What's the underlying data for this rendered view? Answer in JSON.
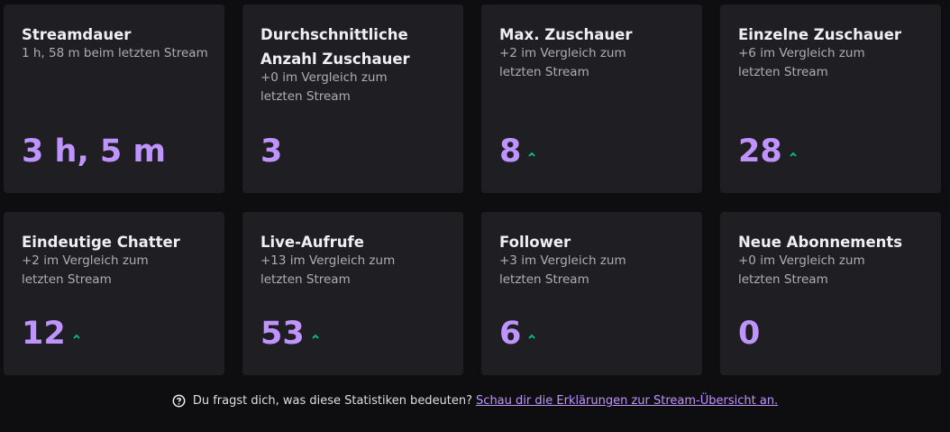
{
  "colors": {
    "accent": "#bf94ff",
    "up": "#00c28f",
    "card_bg": "#1f1f23",
    "page_bg": "#0e0e10"
  },
  "cards": [
    {
      "title": "Streamdauer",
      "sub": "1 h, 58 m beim letzten Stream",
      "value": "3 h, 5 m",
      "trend": ""
    },
    {
      "title": "Durchschnittliche Anzahl Zuschauer",
      "sub": "+0 im Vergleich zum letzten Stream",
      "value": "3",
      "trend": ""
    },
    {
      "title": "Max. Zuschauer",
      "sub": "+2 im Vergleich zum letzten Stream",
      "value": "8",
      "trend": "up"
    },
    {
      "title": "Einzelne Zuschauer",
      "sub": "+6 im Vergleich zum letzten Stream",
      "value": "28",
      "trend": "up"
    },
    {
      "title": "Eindeutige Chatter",
      "sub": "+2 im Vergleich zum letzten Stream",
      "value": "12",
      "trend": "up"
    },
    {
      "title": "Live-Aufrufe",
      "sub": "+13 im Vergleich zum letzten Stream",
      "value": "53",
      "trend": "up"
    },
    {
      "title": "Follower",
      "sub": "+3 im Vergleich zum letzten Stream",
      "value": "6",
      "trend": "up"
    },
    {
      "title": "Neue Abonnements",
      "sub": "+0 im Vergleich zum letzten Stream",
      "value": "0",
      "trend": ""
    }
  ],
  "footer": {
    "question": "Du fragst dich, was diese Statistiken bedeuten?",
    "link": "Schau dir die Erklärungen zur Stream-Übersicht an.",
    "icon": "help-circle-icon"
  }
}
